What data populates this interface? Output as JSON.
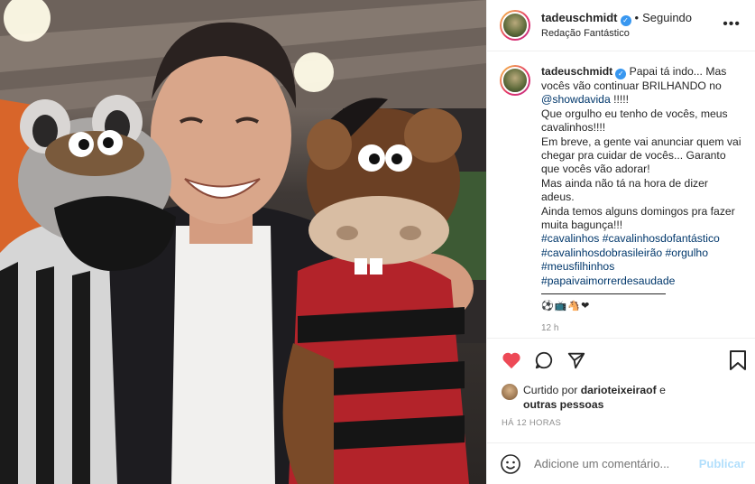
{
  "header": {
    "username": "tadeuschmidt",
    "follow_status": "Seguindo",
    "location": "Redação Fantástico"
  },
  "caption": {
    "username": "tadeuschmidt",
    "lines": [
      "Papai tá indo... Mas",
      "vocês vão continuar BRILHANDO no",
      "@showdavida !!!!!",
      "Que orgulho eu tenho de vocês, meus",
      "cavalinhos!!!!",
      "Em breve, a gente vai anunciar quem vai",
      "chegar pra cuidar de vocês... Garanto",
      "que vocês vão adorar!",
      "Mas ainda não tá na hora de dizer adeus.",
      "Ainda temos alguns domingos pra fazer",
      "muita bagunça!!!"
    ],
    "mention": "@showdavida",
    "hashtags": [
      "#cavalinhos #cavalinhosdofantástico",
      "#cavalinhosdobrasileirão #orgulho",
      "#meusfilhinhos",
      "#papaivaimorrerdesaudade"
    ],
    "emojis": "⚽📺🐴❤",
    "time_small": "12 h"
  },
  "likes": {
    "prefix": "Curtido por",
    "user": "darioteixeiraof",
    "conj": "e",
    "others": "outras pessoas"
  },
  "timestamp": "HÁ 12 HORAS",
  "comment": {
    "placeholder": "Adicione um comentário...",
    "publish_label": "Publicar"
  },
  "icons": {
    "like": "heart-icon",
    "comment": "comment-icon",
    "share": "share-icon",
    "save": "bookmark-icon",
    "emoji": "smiley-icon",
    "more": "more-icon"
  },
  "colors": {
    "like_red": "#ed4956",
    "verified_blue": "#3897f0",
    "link_blue": "#00376b",
    "publish_disabled": "#b2dffc"
  }
}
